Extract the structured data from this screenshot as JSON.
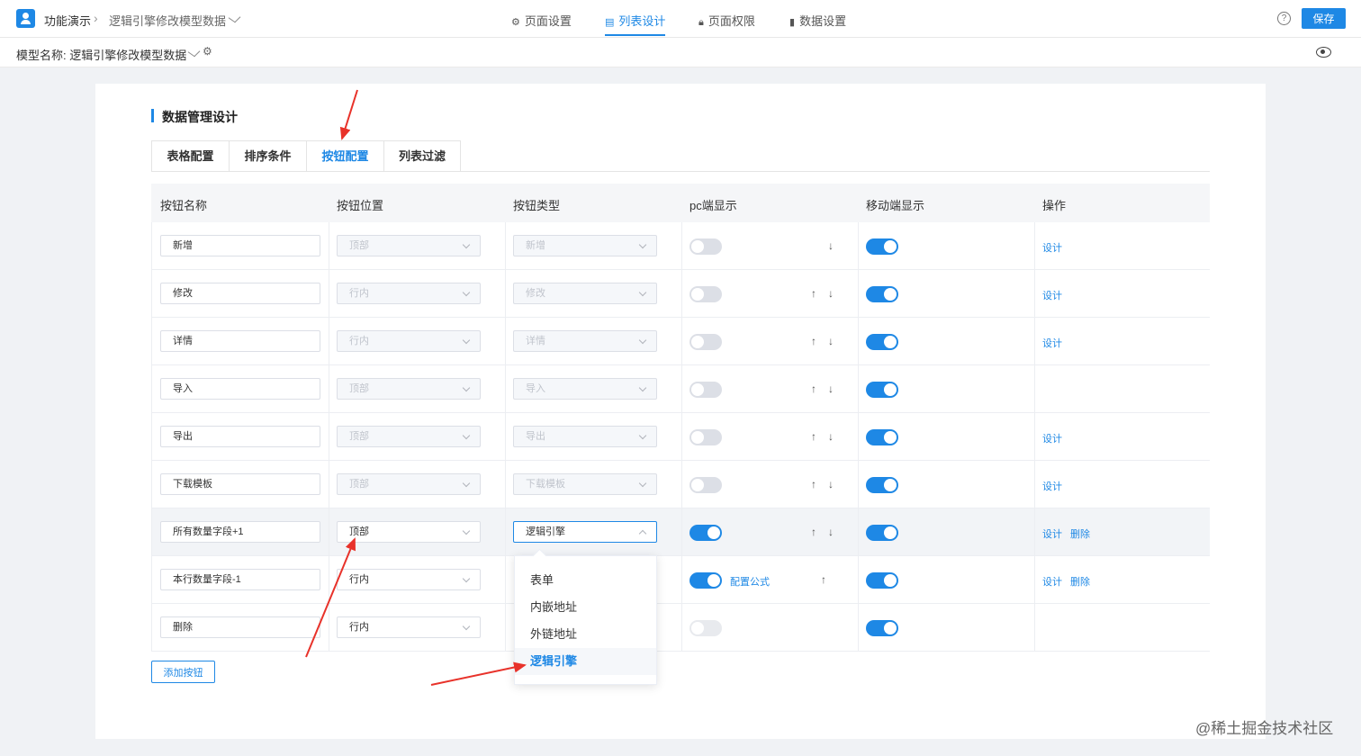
{
  "topbar": {
    "crumb_home": "功能演示",
    "crumb_page": "逻辑引擎修改模型数据",
    "tabs": [
      {
        "label": "页面设置",
        "icon": "gear-icon"
      },
      {
        "label": "列表设计",
        "icon": "list-icon"
      },
      {
        "label": "页面权限",
        "icon": "lock-icon"
      },
      {
        "label": "数据设置",
        "icon": "bar-chart-icon"
      }
    ],
    "active_tab": "列表设计",
    "help": "?",
    "save_label": "保存"
  },
  "model": {
    "label": "模型名称: 逻辑引擎修改模型数据"
  },
  "section": {
    "title": "数据管理设计",
    "subtabs": [
      "表格配置",
      "排序条件",
      "按钮配置",
      "列表过滤"
    ],
    "active_subtab": "按钮配置"
  },
  "table": {
    "headers": [
      "按钮名称",
      "按钮位置",
      "按钮类型",
      "pc端显示",
      "移动端显示",
      "操作"
    ],
    "rows": [
      {
        "name": "新增",
        "position": "顶部",
        "type": "新增",
        "pc": false,
        "mobile": true,
        "up": false,
        "down": true,
        "actions": [
          "设计"
        ]
      },
      {
        "name": "修改",
        "position": "行内",
        "type": "修改",
        "pc": false,
        "mobile": true,
        "up": true,
        "down": true,
        "actions": [
          "设计"
        ]
      },
      {
        "name": "详情",
        "position": "行内",
        "type": "详情",
        "pc": false,
        "mobile": true,
        "up": true,
        "down": true,
        "actions": [
          "设计"
        ]
      },
      {
        "name": "导入",
        "position": "顶部",
        "type": "导入",
        "pc": false,
        "mobile": true,
        "up": true,
        "down": true,
        "actions": []
      },
      {
        "name": "导出",
        "position": "顶部",
        "type": "导出",
        "pc": false,
        "mobile": true,
        "up": true,
        "down": true,
        "actions": [
          "设计"
        ]
      },
      {
        "name": "下载模板",
        "position": "顶部",
        "type": "下载模板",
        "pc": false,
        "mobile": true,
        "up": true,
        "down": true,
        "actions": [
          "设计"
        ]
      },
      {
        "name": "所有数量字段+1",
        "position": "顶部",
        "type": "逻辑引擎",
        "pc": true,
        "mobile": true,
        "up": true,
        "down": true,
        "actions": [
          "设计",
          "删除"
        ]
      },
      {
        "name": "本行数量字段-1",
        "position": "行内",
        "type": "",
        "pc": true,
        "mobile": true,
        "up": true,
        "down": false,
        "formula": "配置公式",
        "actions": [
          "设计",
          "删除"
        ]
      },
      {
        "name": "删除",
        "position": "行内",
        "type": "",
        "pc": false,
        "mobile": true,
        "up": false,
        "down": false,
        "actions": []
      }
    ],
    "add_button": "添加按钮"
  },
  "dropdown": {
    "options": [
      "表单",
      "内嵌地址",
      "外链地址",
      "逻辑引擎"
    ],
    "selected": "逻辑引擎"
  },
  "watermark": "@稀土掘金技术社区",
  "colors": {
    "accent": "#1e88e5",
    "annotation": "#e8322a"
  }
}
